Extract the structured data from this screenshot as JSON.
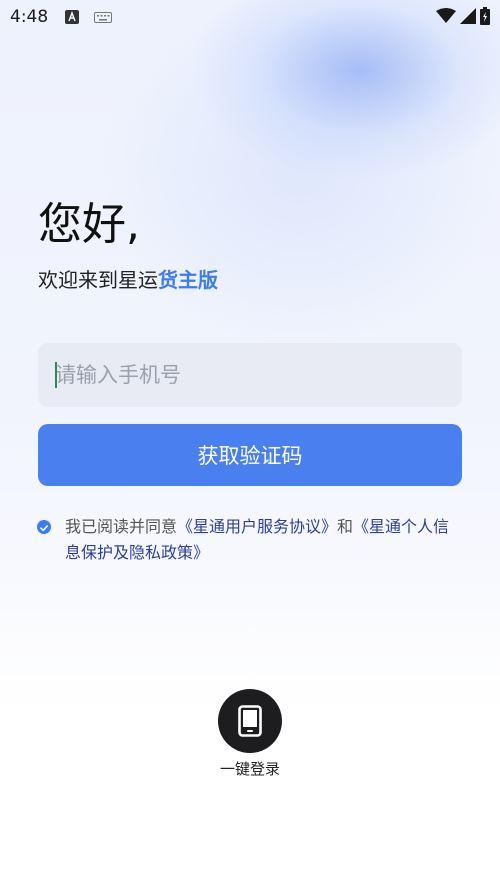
{
  "status_bar": {
    "time": "4:48",
    "icons": [
      "a-notification-icon",
      "keyboard-icon",
      "wifi-icon",
      "signal-icon",
      "battery-icon"
    ]
  },
  "greeting": {
    "title": "您好,",
    "welcome_prefix": "欢迎来到星运",
    "welcome_accent": "货主版"
  },
  "login": {
    "phone_placeholder": "请输入手机号",
    "phone_value": "",
    "get_code_label": "获取验证码"
  },
  "agreement": {
    "checked": true,
    "prefix": "我已阅读并同意",
    "link1": "《星通用户服务协议》",
    "conjunction": "和",
    "link2": "《星通个人信息保护及隐私政策》"
  },
  "one_key_login": {
    "label": "一键登录",
    "icon": "phone-icon"
  },
  "colors": {
    "accent": "#3d7bf0",
    "button": "#4a7ff0",
    "link": "#2a3f9e",
    "input_bg": "#e8ebf3"
  }
}
